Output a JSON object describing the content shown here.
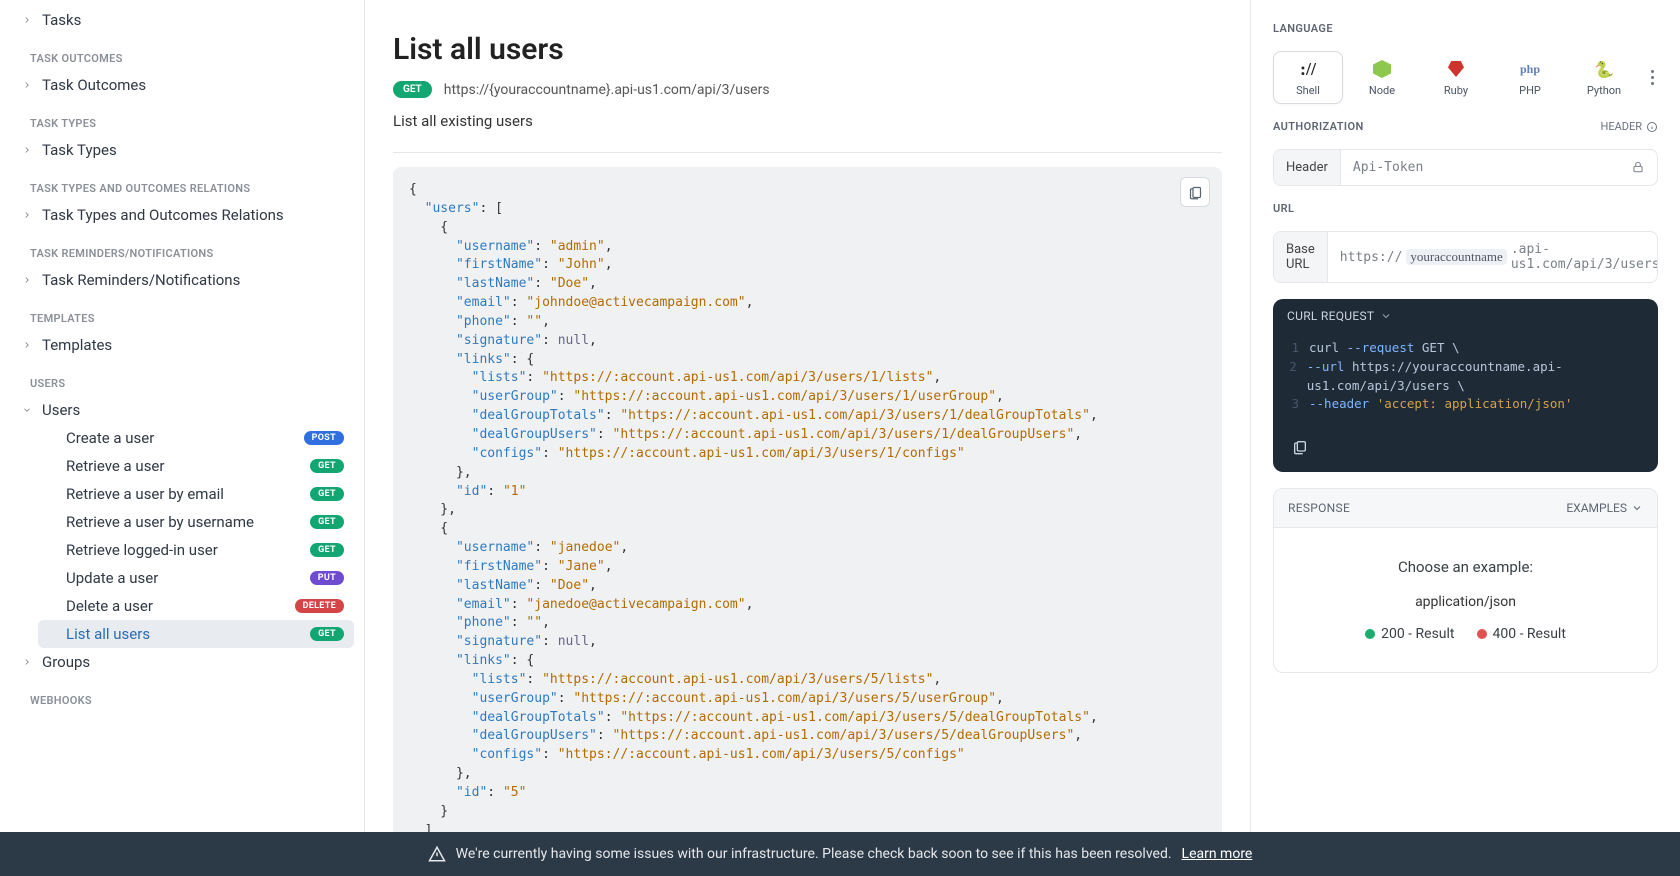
{
  "sidebar": {
    "groups": [
      {
        "heading": null,
        "items": [
          {
            "label": "Tasks",
            "caret": "right",
            "method": null
          }
        ]
      },
      {
        "heading": "TASK OUTCOMES",
        "items": [
          {
            "label": "Task Outcomes",
            "caret": "right",
            "method": null
          }
        ]
      },
      {
        "heading": "TASK TYPES",
        "items": [
          {
            "label": "Task Types",
            "caret": "right",
            "method": null
          }
        ]
      },
      {
        "heading": "TASK TYPES AND OUTCOMES RELATIONS",
        "items": [
          {
            "label": "Task Types and Outcomes Relations",
            "caret": "right",
            "method": null
          }
        ]
      },
      {
        "heading": "TASK REMINDERS/NOTIFICATIONS",
        "items": [
          {
            "label": "Task Reminders/Notifications",
            "caret": "right",
            "method": null
          }
        ]
      },
      {
        "heading": "TEMPLATES",
        "items": [
          {
            "label": "Templates",
            "caret": "right",
            "method": null
          }
        ]
      },
      {
        "heading": "USERS",
        "items": [
          {
            "label": "Users",
            "caret": "down",
            "method": null,
            "children": [
              {
                "label": "Create a user",
                "method": "POST"
              },
              {
                "label": "Retrieve a user",
                "method": "GET"
              },
              {
                "label": "Retrieve a user by email",
                "method": "GET"
              },
              {
                "label": "Retrieve a user by username",
                "method": "GET"
              },
              {
                "label": "Retrieve logged-in user",
                "method": "GET"
              },
              {
                "label": "Update a user",
                "method": "PUT"
              },
              {
                "label": "Delete a user",
                "method": "DELETE"
              },
              {
                "label": "List all users",
                "method": "GET",
                "active": true
              }
            ]
          },
          {
            "label": "Groups",
            "caret": "right",
            "method": null
          }
        ]
      },
      {
        "heading": "WEBHOOKS",
        "items": []
      }
    ]
  },
  "main": {
    "title": "List all users",
    "method": "GET",
    "endpoint_url": "https://{youraccountname}.api-us1.com/api/3/users",
    "description": "List all existing users",
    "response_example": {
      "users": [
        {
          "username": "admin",
          "firstName": "John",
          "lastName": "Doe",
          "email": "johndoe@activecampaign.com",
          "phone": "",
          "signature": null,
          "links": {
            "lists": "https://:account.api-us1.com/api/3/users/1/lists",
            "userGroup": "https://:account.api-us1.com/api/3/users/1/userGroup",
            "dealGroupTotals": "https://:account.api-us1.com/api/3/users/1/dealGroupTotals",
            "dealGroupUsers": "https://:account.api-us1.com/api/3/users/1/dealGroupUsers",
            "configs": "https://:account.api-us1.com/api/3/users/1/configs"
          },
          "id": "1"
        },
        {
          "username": "janedoe",
          "firstName": "Jane",
          "lastName": "Doe",
          "email": "janedoe@activecampaign.com",
          "phone": "",
          "signature": null,
          "links": {
            "lists": "https://:account.api-us1.com/api/3/users/5/lists",
            "userGroup": "https://:account.api-us1.com/api/3/users/5/userGroup",
            "dealGroupTotals": "https://:account.api-us1.com/api/3/users/5/dealGroupTotals",
            "dealGroupUsers": "https://:account.api-us1.com/api/3/users/5/dealGroupUsers",
            "configs": "https://:account.api-us1.com/api/3/users/5/configs"
          },
          "id": "5"
        }
      ]
    }
  },
  "right": {
    "language_label": "LANGUAGE",
    "languages": [
      {
        "name": "Shell",
        "selected": true,
        "icon": "shell"
      },
      {
        "name": "Node",
        "selected": false,
        "icon": "node"
      },
      {
        "name": "Ruby",
        "selected": false,
        "icon": "ruby"
      },
      {
        "name": "PHP",
        "selected": false,
        "icon": "php"
      },
      {
        "name": "Python",
        "selected": false,
        "icon": "python"
      }
    ],
    "authorization_label": "AUTHORIZATION",
    "authorization_right": "HEADER",
    "header_label": "Header",
    "header_value": "Api-Token",
    "url_label": "URL",
    "base_url_label": "Base URL",
    "base_url_prefix": "https://",
    "base_url_variable": "youraccountname",
    "base_url_suffix": ".api-us1.com/api/3/users",
    "curl": {
      "title": "CURL REQUEST",
      "lines": [
        {
          "n": "1",
          "segments": [
            {
              "t": "curl ",
              "c": "cmd"
            },
            {
              "t": "--request",
              "c": "flag"
            },
            {
              "t": " GET \\",
              "c": "cmd"
            }
          ]
        },
        {
          "n": "2",
          "segments": [
            {
              "t": "     ",
              "c": "cmd"
            },
            {
              "t": "--url",
              "c": "flag"
            },
            {
              "t": " https://youraccountname.api-us1.com/api/3/users \\",
              "c": "cmd"
            }
          ]
        },
        {
          "n": "3",
          "segments": [
            {
              "t": "     ",
              "c": "cmd"
            },
            {
              "t": "--header",
              "c": "flag"
            },
            {
              "t": " ",
              "c": "cmd"
            },
            {
              "t": "'accept: application/json'",
              "c": "str"
            }
          ]
        }
      ]
    },
    "response": {
      "label": "RESPONSE",
      "examples_label": "EXAMPLES",
      "choose_hint": "Choose an example:",
      "content_type": "application/json",
      "examples": [
        {
          "color": "green",
          "label": "200 - Result"
        },
        {
          "color": "red",
          "label": "400 - Result"
        }
      ]
    }
  },
  "banner": {
    "icon": "warning",
    "text": "We're currently having some issues with our infrastructure. Please check back soon to see if this has been resolved.",
    "link": "Learn more"
  }
}
